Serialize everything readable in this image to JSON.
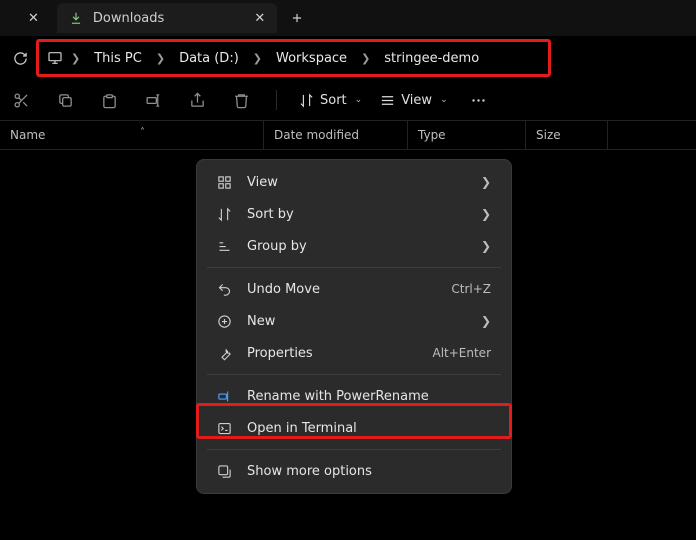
{
  "tabs": {
    "downloads_label": "Downloads"
  },
  "breadcrumbs": {
    "pc": "This PC",
    "drive": "Data (D:)",
    "workspace": "Workspace",
    "folder": "stringee-demo"
  },
  "toolbar": {
    "sort": "Sort",
    "view": "View"
  },
  "columns": {
    "name": "Name",
    "date": "Date modified",
    "type": "Type",
    "size": "Size"
  },
  "context_menu": {
    "view": "View",
    "sort_by": "Sort by",
    "group_by": "Group by",
    "undo_move": "Undo Move",
    "undo_move_accel": "Ctrl+Z",
    "new": "New",
    "properties": "Properties",
    "properties_accel": "Alt+Enter",
    "rename_power": "Rename with PowerRename",
    "open_terminal": "Open in Terminal",
    "show_more": "Show more options"
  }
}
